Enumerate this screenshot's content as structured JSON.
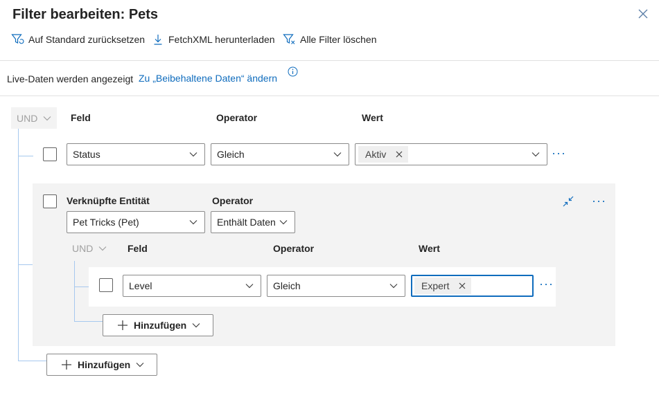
{
  "dialog": {
    "title": "Filter bearbeiten: Pets",
    "close_icon": "close-icon"
  },
  "toolbar": {
    "reset_label": "Auf Standard zurücksetzen",
    "download_label": "FetchXML herunterladen",
    "clear_label": "Alle Filter löschen"
  },
  "live_data": {
    "status_text": "Live-Daten werden angezeigt",
    "link_text": "Zu „Beibehaltene Daten“ ändern"
  },
  "root_group": {
    "logic": "UND",
    "headers": {
      "field": "Feld",
      "operator": "Operator",
      "value": "Wert"
    },
    "row": {
      "field": "Status",
      "operator": "Gleich",
      "value_tag": "Aktiv"
    },
    "add_label": "Hinzufügen"
  },
  "related_entity": {
    "entity_label": "Verknüpfte Entität",
    "operator_label": "Operator",
    "entity_value": "Pet Tricks (Pet)",
    "operator_value": "Enthält Daten",
    "inner_group": {
      "logic": "UND",
      "headers": {
        "field": "Feld",
        "operator": "Operator",
        "value": "Wert"
      },
      "row": {
        "field": "Level",
        "operator": "Gleich",
        "value_tag": "Expert"
      },
      "add_label": "Hinzufügen"
    }
  },
  "colors": {
    "accent": "#0f6cbd",
    "tree_line": "#a6c8ee",
    "group_bg": "#f3f3f3"
  }
}
